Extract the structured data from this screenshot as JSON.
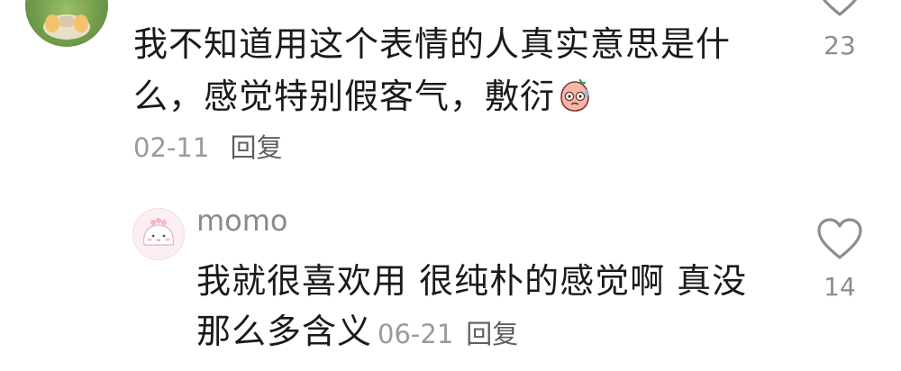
{
  "comment": {
    "text": "我不知道用这个表情的人真实意思是什么，感觉特别假客气，敷衍",
    "emoji": "sweat-face-emoji",
    "date": "02-11",
    "reply_label": "回复",
    "like_count": "23"
  },
  "reply": {
    "username": "momo",
    "text": "我就很喜欢用 很纯朴的感觉啊 真没那么多含义",
    "date": "06-21",
    "reply_label": "回复",
    "like_count": "14"
  },
  "icons": {
    "like": "heart-outline-icon"
  },
  "colors": {
    "text": "#1a1a1a",
    "meta": "#9a9a9a",
    "reply_action": "#5e5e5e",
    "icon": "#8d8d8d"
  }
}
